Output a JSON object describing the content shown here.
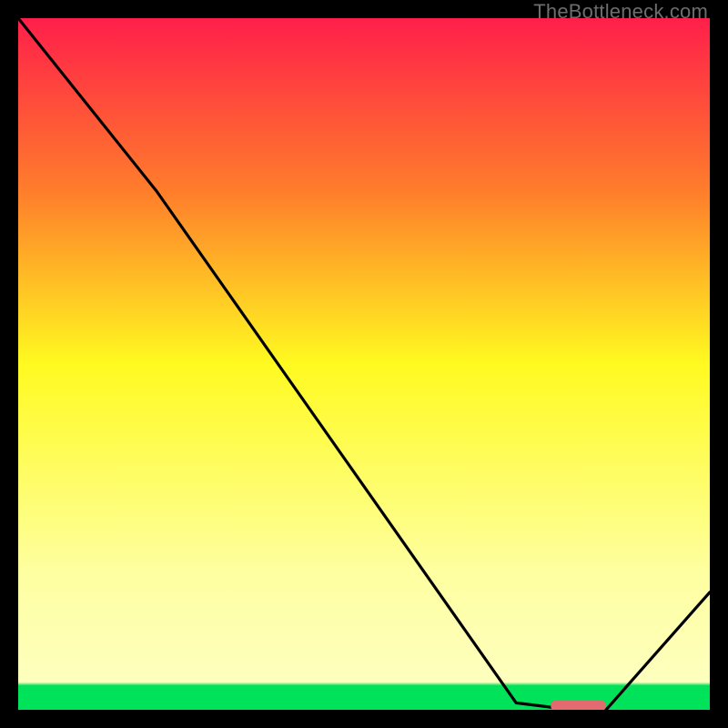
{
  "watermark": {
    "text": "TheBottleneck.com"
  },
  "colors": {
    "green": "#00e25a",
    "yellow_pale": "#feffa0",
    "yellow": "#fffa20",
    "orange_mid": "#ffaa28",
    "orange": "#ff7d2b",
    "red_orange": "#ff5a38",
    "red": "#ff1f4a",
    "curve": "#000000",
    "marker": "#e36a6e",
    "frame": "#000000"
  },
  "chart_data": {
    "type": "line",
    "title": "",
    "xlabel": "",
    "ylabel": "",
    "xlim": [
      0,
      100
    ],
    "ylim": [
      0,
      100
    ],
    "grid": false,
    "legend": false,
    "gradient_stops": [
      {
        "offset": 0.0,
        "color": "#ff1f4a"
      },
      {
        "offset": 0.25,
        "color": "#ff7d2b"
      },
      {
        "offset": 0.5,
        "color": "#fffa20"
      },
      {
        "offset": 0.8,
        "color": "#feffa0"
      },
      {
        "offset": 0.96,
        "color": "#feffbe"
      },
      {
        "offset": 0.965,
        "color": "#00e25a"
      },
      {
        "offset": 1.0,
        "color": "#00e25a"
      }
    ],
    "series": [
      {
        "name": "bottleneck-curve",
        "x": [
          0,
          20,
          72,
          80,
          85,
          100
        ],
        "y": [
          100,
          75,
          1,
          0,
          0,
          17
        ]
      }
    ],
    "marker": {
      "name": "optimal-range",
      "shape": "rounded-bar",
      "x_range": [
        77,
        85
      ],
      "y": 0,
      "color": "#e36a6e"
    },
    "notes": "Background is a vertical red→yellow→green gradient indicating bottleneck severity (red high, green low). Black curve is the bottleneck metric. Small salmon bar at the valley marks the recommended/optimal region. Values are estimated from the image; no axis ticks or numeric labels are rendered."
  }
}
